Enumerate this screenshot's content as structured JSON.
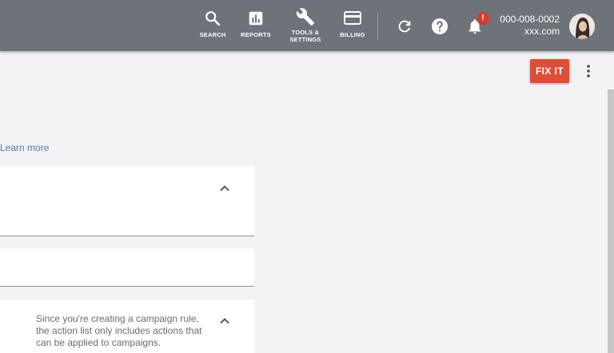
{
  "header": {
    "nav": [
      {
        "label": "SEARCH",
        "icon": "search-icon"
      },
      {
        "label": "REPORTS",
        "icon": "reports-icon"
      },
      {
        "label": "TOOLS &\nSETTINGS",
        "icon": "wrench-icon"
      },
      {
        "label": "BILLING",
        "icon": "billing-card-icon"
      }
    ],
    "notification_badge": "!",
    "account": {
      "id": "000-008-0002",
      "domain": "xxx.com"
    }
  },
  "toolbar": {
    "fix_label": "FIX IT"
  },
  "content": {
    "learn_more": "Learn more",
    "info_text": "Since you're creating a campaign rule, the action list only includes actions that can be applied to campaigns."
  },
  "colors": {
    "header_bg": "#6d7378",
    "fix_button": "#dc4e3a",
    "link": "#4a7bb5",
    "badge": "#d23f31"
  }
}
